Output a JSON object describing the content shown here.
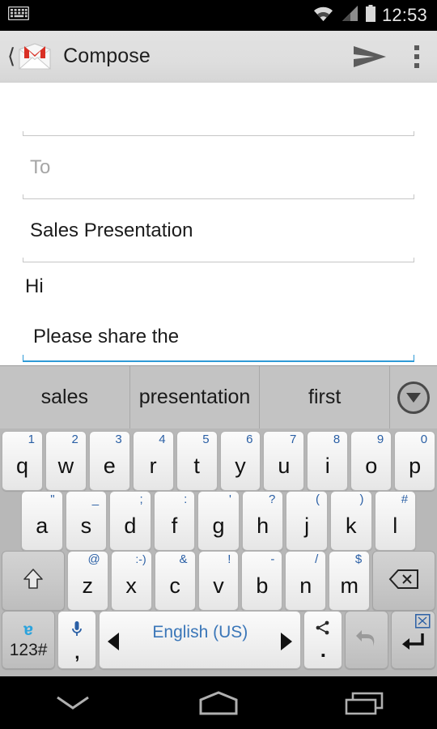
{
  "status_bar": {
    "notification_icon": "keyboard-icon",
    "wifi_icon": "wifi-icon",
    "signal_icon": "cell-signal-icon",
    "battery_icon": "battery-icon",
    "time": "12:53"
  },
  "action_bar": {
    "back_icon": "back-chevron-icon",
    "app_icon": "gmail-icon",
    "title": "Compose",
    "send_icon": "send-icon",
    "overflow_icon": "overflow-menu-icon"
  },
  "compose": {
    "from_value": "",
    "to_placeholder": "To",
    "to_value": "",
    "subject_value": "Sales Presentation",
    "body_line_1": "Hi",
    "body_line_2": "Please share the",
    "focused_underline_color": "#2e9ad6",
    "unfocused_underline_color": "#c6c6c6"
  },
  "keyboard": {
    "suggestions": [
      "sales",
      "presentation",
      "first"
    ],
    "expand_icon": "chevron-down-circle-icon",
    "row1": [
      {
        "label": "q",
        "hint": "1"
      },
      {
        "label": "w",
        "hint": "2"
      },
      {
        "label": "e",
        "hint": "3"
      },
      {
        "label": "r",
        "hint": "4"
      },
      {
        "label": "t",
        "hint": "5"
      },
      {
        "label": "y",
        "hint": "6"
      },
      {
        "label": "u",
        "hint": "7"
      },
      {
        "label": "i",
        "hint": "8"
      },
      {
        "label": "o",
        "hint": "9"
      },
      {
        "label": "p",
        "hint": "0"
      }
    ],
    "row2": [
      {
        "label": "a",
        "hint": "\""
      },
      {
        "label": "s",
        "hint": "_"
      },
      {
        "label": "d",
        "hint": ";"
      },
      {
        "label": "f",
        "hint": ":"
      },
      {
        "label": "g",
        "hint": "'"
      },
      {
        "label": "h",
        "hint": "?"
      },
      {
        "label": "j",
        "hint": "("
      },
      {
        "label": "k",
        "hint": ")"
      },
      {
        "label": "l",
        "hint": "#"
      }
    ],
    "row3": [
      {
        "label": "z",
        "hint": "@"
      },
      {
        "label": "x",
        "hint": ":-)"
      },
      {
        "label": "c",
        "hint": "&"
      },
      {
        "label": "v",
        "hint": "!"
      },
      {
        "label": "b",
        "hint": "-"
      },
      {
        "label": "n",
        "hint": "/"
      },
      {
        "label": "m",
        "hint": "$"
      }
    ],
    "shift_icon": "shift-arrow-icon",
    "backspace_icon": "backspace-icon",
    "symbols_key": {
      "icon": "handwriting-a-icon",
      "label": "123#"
    },
    "comma_key": {
      "icon": "microphone-icon",
      "label": ","
    },
    "space_key": {
      "language": "English (US)",
      "left_arrow": "arrow-left-icon",
      "right_arrow": "arrow-right-icon"
    },
    "period_key": {
      "icon": "share-icon",
      "label": "."
    },
    "undo_key": {
      "icon": "undo-arrow-icon"
    },
    "enter_key": {
      "icon": "enter-return-icon",
      "hint_icon": "cut-scissors-icon"
    }
  },
  "nav_bar": {
    "back_icon": "hide-keyboard-chevron-icon",
    "home_icon": "home-icon",
    "recents_icon": "recent-apps-icon"
  }
}
